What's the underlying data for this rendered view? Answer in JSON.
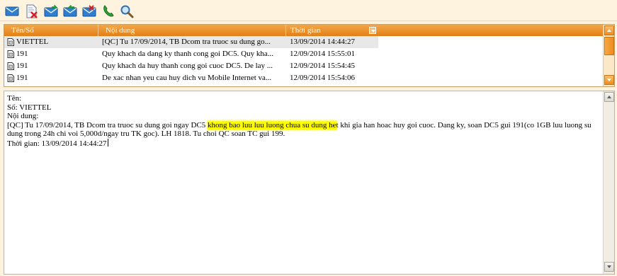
{
  "toolbar": {
    "buttons": [
      {
        "name": "new-message",
        "icon": "envelope-icon"
      },
      {
        "name": "delete-message",
        "icon": "document-delete-icon"
      },
      {
        "name": "forward-message",
        "icon": "envelope-forward-icon"
      },
      {
        "name": "reply-message",
        "icon": "envelope-reply-icon"
      },
      {
        "name": "send-receive",
        "icon": "envelope-exchange-icon"
      },
      {
        "name": "call",
        "icon": "phone-icon"
      },
      {
        "name": "search",
        "icon": "magnifier-icon"
      }
    ]
  },
  "list": {
    "columns": {
      "name": "Tên/Số",
      "content": "Nội dung",
      "time": "Thời gian"
    },
    "rows": [
      {
        "name": "VIETTEL",
        "content": "[QC] Tu 17/09/2014, TB Dcom tra truoc su dung go...",
        "time": "13/09/2014 14:44:27",
        "selected": true
      },
      {
        "name": "191",
        "content": "Quy khach da dang ky thanh cong goi DC5. Quy kha...",
        "time": "12/09/2014 15:55:01",
        "selected": false
      },
      {
        "name": "191",
        "content": "Quy khach da huy thanh cong goi cuoc DC5. De lay ...",
        "time": "12/09/2014 15:54:45",
        "selected": false
      },
      {
        "name": "191",
        "content": "De xac nhan yeu cau huy dich vu Mobile Internet va...",
        "time": "12/09/2014 15:54:06",
        "selected": false
      }
    ]
  },
  "detail": {
    "name_line": "Tên:",
    "number_line": "Số: VIETTEL",
    "content_label": "Nội dung:",
    "body_before": "[QC] Tu 17/09/2014, TB Dcom tra truoc su dung goi ngay DC5 ",
    "body_highlight": "khong bao luu luu luong chua su dung he",
    "body_after": "t khi gia han hoac huy goi cuoc. Dang ky, soan DC5 gui 191(co 1GB luu luong su dung trong 24h chi voi 5,000d/ngay tru TK goc). LH 1818. Tu choi QC soan TC gui 199.",
    "time_line": "Thời gian: 13/09/2014 14:44:27"
  },
  "colors": {
    "accent": "#e8891e",
    "highlight": "#ffff00",
    "background": "#fdf3df"
  }
}
